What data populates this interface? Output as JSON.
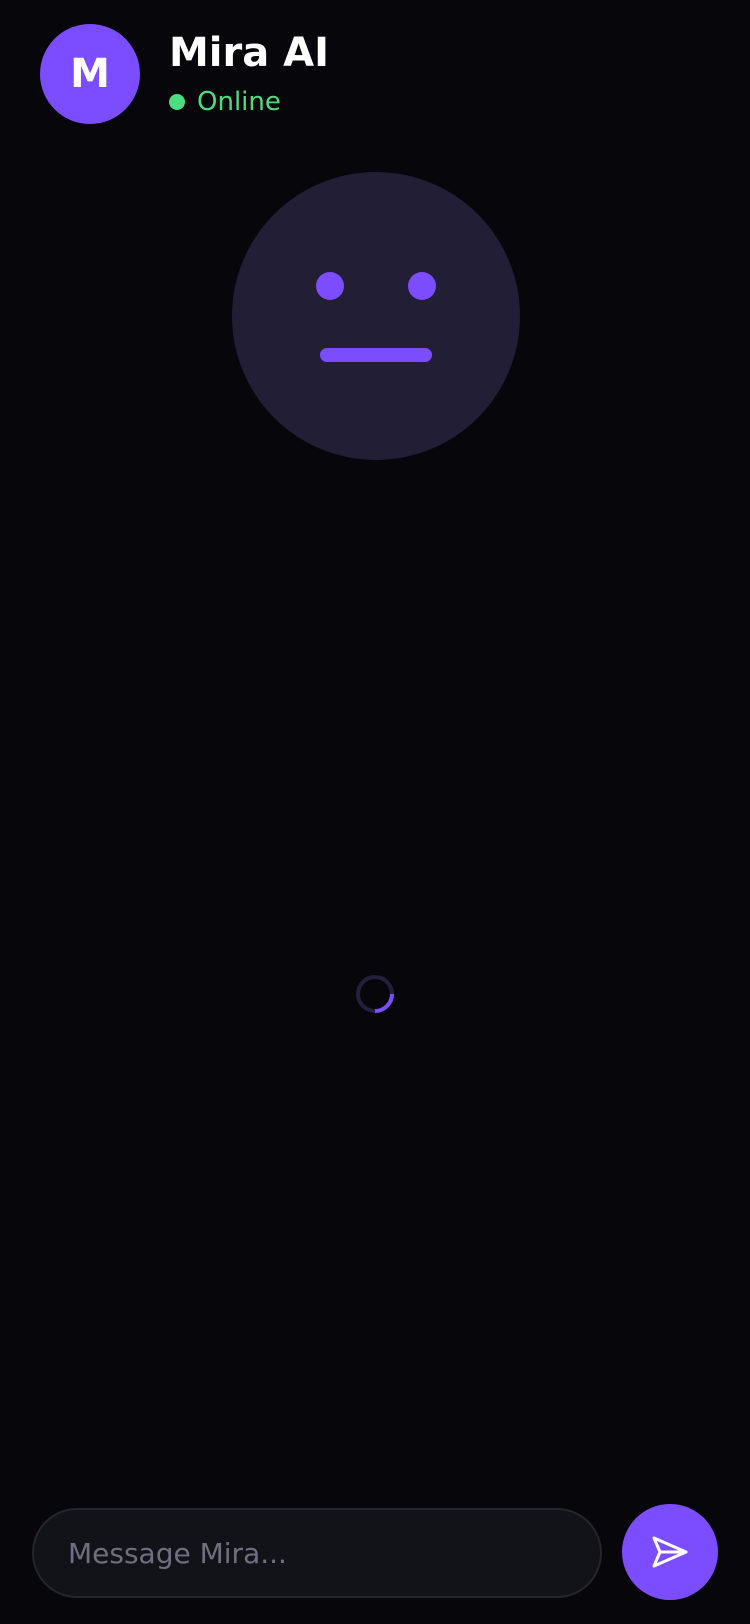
{
  "header": {
    "avatar_initial": "M",
    "title": "Mira AI",
    "status": "Online",
    "status_color": "#4ade80"
  },
  "assistant_face": {
    "expression": "neutral",
    "face_color": "#211e36",
    "feature_color": "#7c4dff"
  },
  "loading": {
    "icon": "loading-spinner-icon"
  },
  "composer": {
    "placeholder": "Message Mira...",
    "value": "",
    "send_icon": "send-icon"
  },
  "theme": {
    "background": "#07070b",
    "accent": "#7c4dff"
  }
}
